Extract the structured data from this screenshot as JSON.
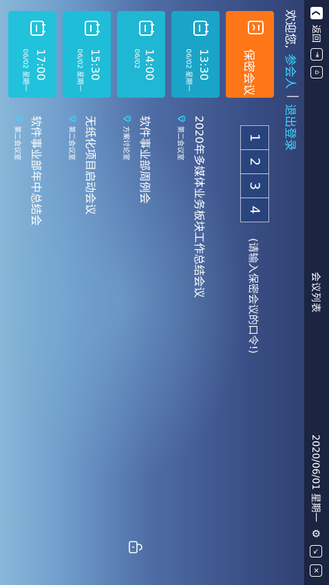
{
  "topbar": {
    "back_label": "返回",
    "title": "会议列表",
    "datetime": "2020/06/01   星期一"
  },
  "welcome": {
    "greeting": "欢迎您,",
    "user": "参会人",
    "separator": "|",
    "logout": "退出登录"
  },
  "secret_card": {
    "label": "保密会议"
  },
  "keypad": {
    "keys": [
      "1",
      "2",
      "3",
      "4"
    ],
    "hint": "(请输入保密会议的口令!)"
  },
  "meetings": [
    {
      "time": "13:30",
      "date": "06/02 星期一",
      "title": "2020年多媒体业务板块工作总结会议",
      "room": "第二会议室"
    },
    {
      "time": "14:00",
      "date": "06/02",
      "title": "软件事业部周例会",
      "room": "方案讨论室"
    },
    {
      "time": "15:30",
      "date": "06/02 星期一",
      "title": "无纸化项目启动会议",
      "room": "第二会议室"
    },
    {
      "time": "17:00",
      "date": "06/02 星期一",
      "title": "软件事业部年中总结会",
      "room": "第二会议室"
    }
  ],
  "colors": {
    "secret_orange": "#ff7618",
    "card_cyan": "#1fb7d3",
    "link_cyan": "#37d7ff",
    "topbar_bg": "#1b2440"
  }
}
